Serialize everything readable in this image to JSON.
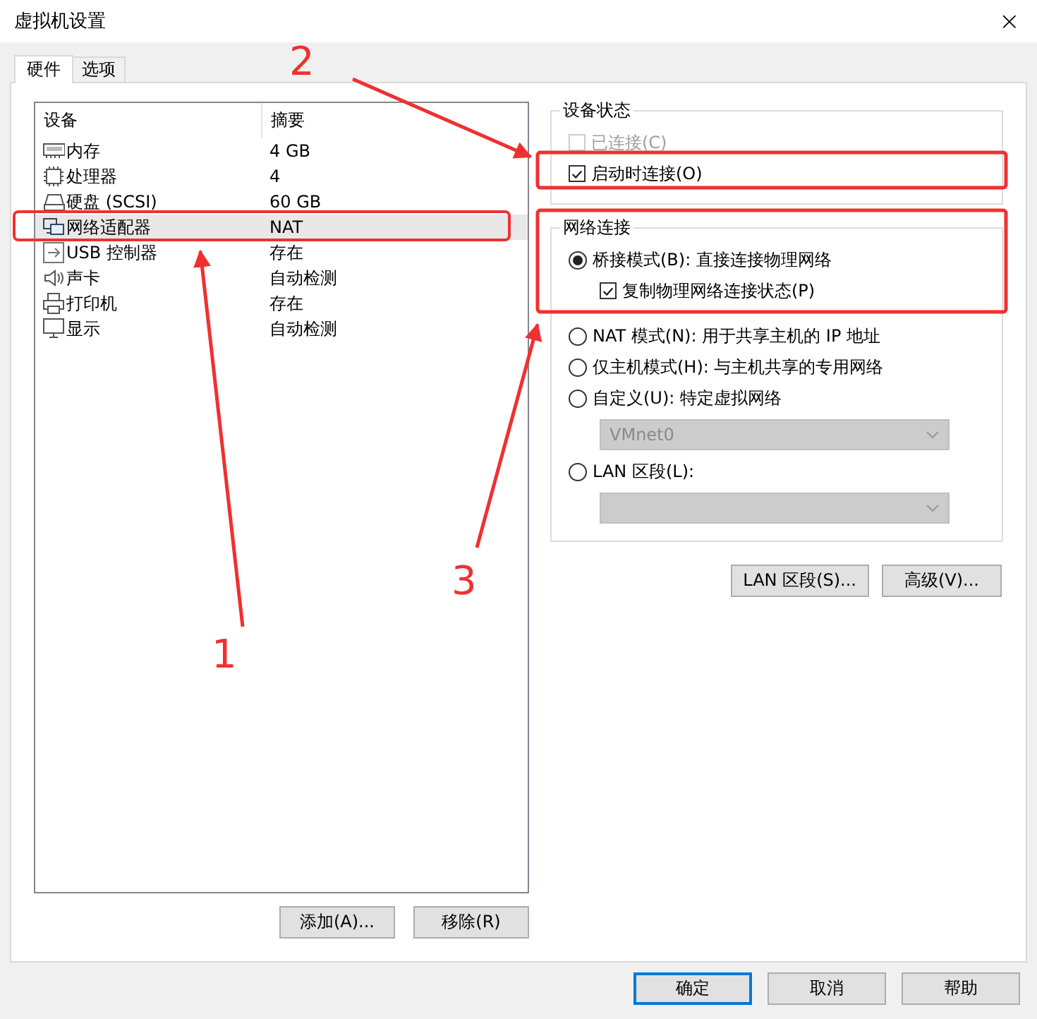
{
  "window": {
    "title": "虚拟机设置",
    "close": "×"
  },
  "tabs": [
    {
      "label": "硬件",
      "selected": true
    },
    {
      "label": "选项",
      "selected": false
    }
  ],
  "device_list": {
    "columns": [
      "设备",
      "摘要"
    ],
    "rows": [
      {
        "device": "内存",
        "summary": "4 GB",
        "selected": false
      },
      {
        "device": "处理器",
        "summary": "4",
        "selected": false
      },
      {
        "device": "硬盘 (SCSI)",
        "summary": "60 GB",
        "selected": false
      },
      {
        "device": "网络适配器",
        "summary": "NAT",
        "selected": true
      },
      {
        "device": "USB 控制器",
        "summary": "存在",
        "selected": false
      },
      {
        "device": "声卡",
        "summary": "自动检测",
        "selected": false
      },
      {
        "device": "打印机",
        "summary": "存在",
        "selected": false
      },
      {
        "device": "显示",
        "summary": "自动检测",
        "selected": false
      }
    ]
  },
  "device_buttons": [
    "添加(A)...",
    "移除(R)"
  ],
  "device_status": {
    "title": "设备状态",
    "options": [
      {
        "label": "已连接(C)",
        "checked": false,
        "disabled": true
      },
      {
        "label": "启动时连接(O)",
        "checked": true,
        "disabled": false
      }
    ]
  },
  "network": {
    "title": "网络连接",
    "options": [
      {
        "kind": "radio",
        "label": "桥接模式(B): 直接连接物理网络",
        "selected": true,
        "disabled": false
      },
      {
        "kind": "checkbox",
        "label": "复制物理网络连接状态(P)",
        "checked": true,
        "disabled": false
      },
      {
        "kind": "radio",
        "label": "NAT 模式(N): 用于共享主机的 IP 地址",
        "selected": false,
        "disabled": false
      },
      {
        "kind": "radio",
        "label": "仅主机模式(H): 与主机共享的专用网络",
        "selected": false,
        "disabled": false
      },
      {
        "kind": "radio",
        "label": "自定义(U): 特定虚拟网络",
        "selected": false,
        "disabled": false
      },
      {
        "kind": "select",
        "value": "VMnet0",
        "disabled": true
      },
      {
        "kind": "radio",
        "label": "LAN 区段(L):",
        "selected": false,
        "disabled": false
      },
      {
        "kind": "select",
        "disabled": true
      }
    ]
  },
  "network_buttons": [
    "LAN 区段(S)...",
    "高级(V)..."
  ],
  "dialog_buttons": [
    {
      "label": "确定",
      "default": true
    },
    {
      "label": "取消",
      "default": false
    },
    {
      "label": "帮助",
      "default": false
    }
  ],
  "annotations": [
    {
      "label": "1"
    },
    {
      "label": "2"
    },
    {
      "label": "3"
    }
  ]
}
